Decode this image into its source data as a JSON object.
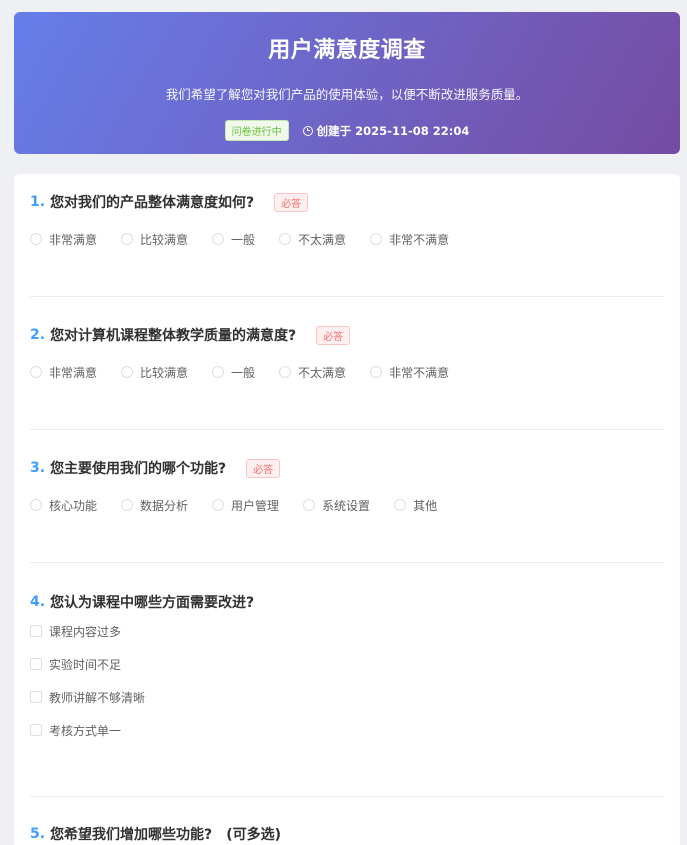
{
  "header": {
    "title": "用户满意度调查",
    "description": "我们希望了解您对我们产品的使用体验，以便不断改进服务质量。",
    "status": "问卷进行中",
    "created": "创建于 2025-11-08 22:04"
  },
  "colors": {
    "gradient_start": "#667eea",
    "gradient_end": "#764ba2",
    "question_number": "#409eff",
    "required": "#f56c6c",
    "status": "#67c23a"
  },
  "questions": [
    {
      "num": "1.",
      "text": "您对我们的产品整体满意度如何?",
      "required": "必答",
      "type": "radio",
      "options": [
        "非常满意",
        "比较满意",
        "一般",
        "不太满意",
        "非常不满意"
      ]
    },
    {
      "num": "2.",
      "text": "您对计算机课程整体教学质量的满意度?",
      "required": "必答",
      "type": "radio",
      "options": [
        "非常满意",
        "比较满意",
        "一般",
        "不太满意",
        "非常不满意"
      ]
    },
    {
      "num": "3.",
      "text": "您主要使用我们的哪个功能?",
      "required": "必答",
      "type": "radio",
      "options": [
        "核心功能",
        "数据分析",
        "用户管理",
        "系统设置",
        "其他"
      ]
    },
    {
      "num": "4.",
      "text": "您认为课程中哪些方面需要改进?",
      "type": "checkbox",
      "options": [
        "课程内容过多",
        "实验时间不足",
        "教师讲解不够清晰",
        "考核方式单一"
      ]
    },
    {
      "num": "5.",
      "text": "您希望我们增加哪些功能?",
      "tip": "(可多选)"
    }
  ]
}
